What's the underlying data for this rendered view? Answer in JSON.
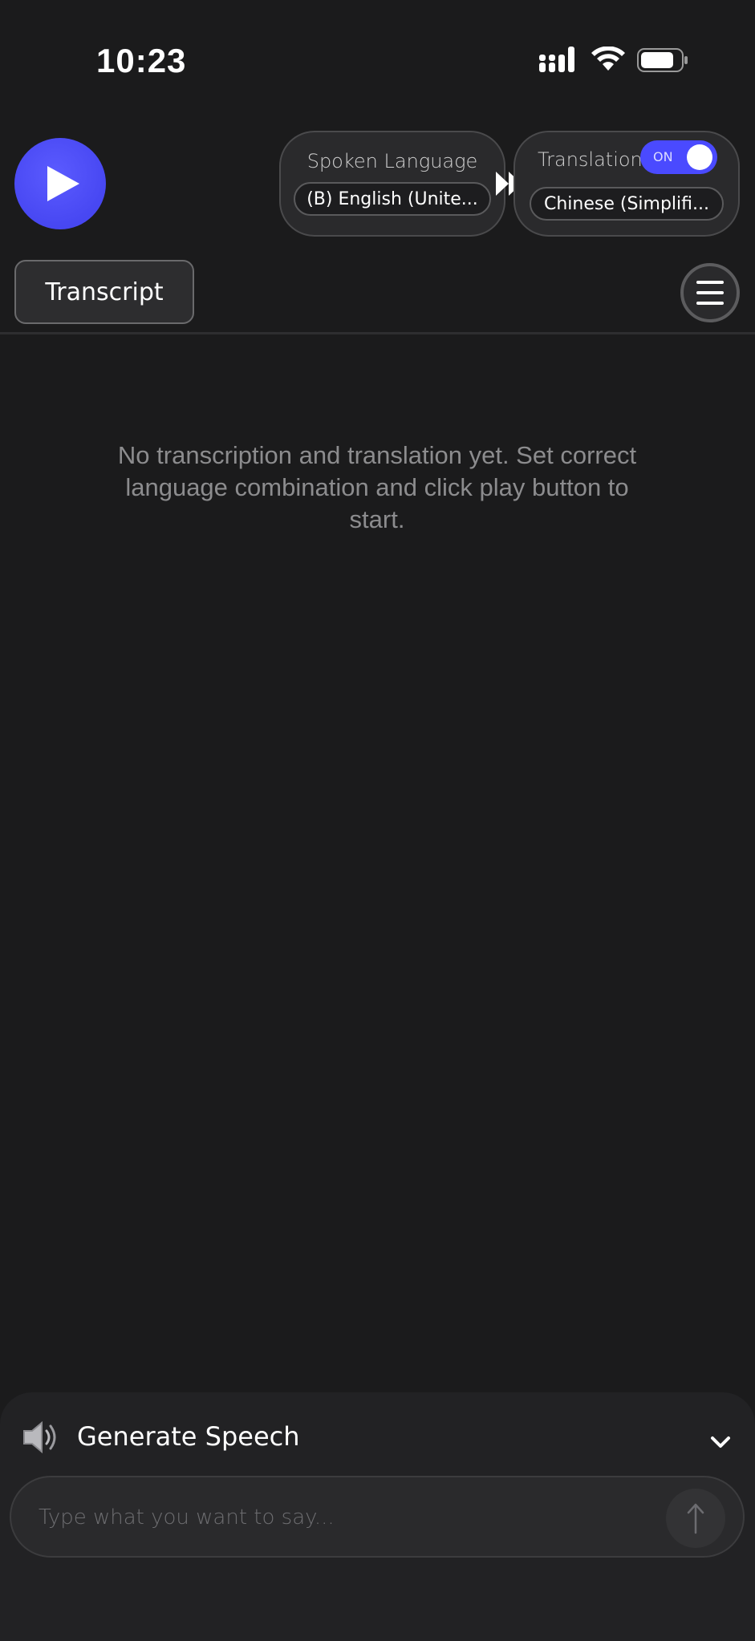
{
  "status_bar": {
    "time": "10:23",
    "icons": [
      "cellular-signal-icon",
      "wifi-icon",
      "battery-icon"
    ]
  },
  "header": {
    "play_icon": "play-icon",
    "spoken_language": {
      "label": "Spoken Language",
      "value": "(B) English (Unite..."
    },
    "direction_icon": "double-arrow-right-icon",
    "translation": {
      "label": "Translation",
      "toggle_label": "ON",
      "toggle_on": true,
      "value": "Chinese (Simplifi..."
    }
  },
  "tabs": {
    "transcript_label": "Transcript",
    "menu_icon": "hamburger-menu-icon"
  },
  "main": {
    "empty_message": "No transcription and translation yet. Set correct language combination and click play button to start."
  },
  "generate_speech": {
    "icon": "speaker-icon",
    "label": "Generate Speech",
    "chevron_icon": "chevron-down-icon",
    "input_placeholder": "Type what you want to say...",
    "send_icon": "arrow-up-icon"
  },
  "colors": {
    "background": "#1b1b1c",
    "accent": "#4a4aff",
    "panel": "#2a2a2c",
    "muted_text": "#8c8c8e"
  }
}
